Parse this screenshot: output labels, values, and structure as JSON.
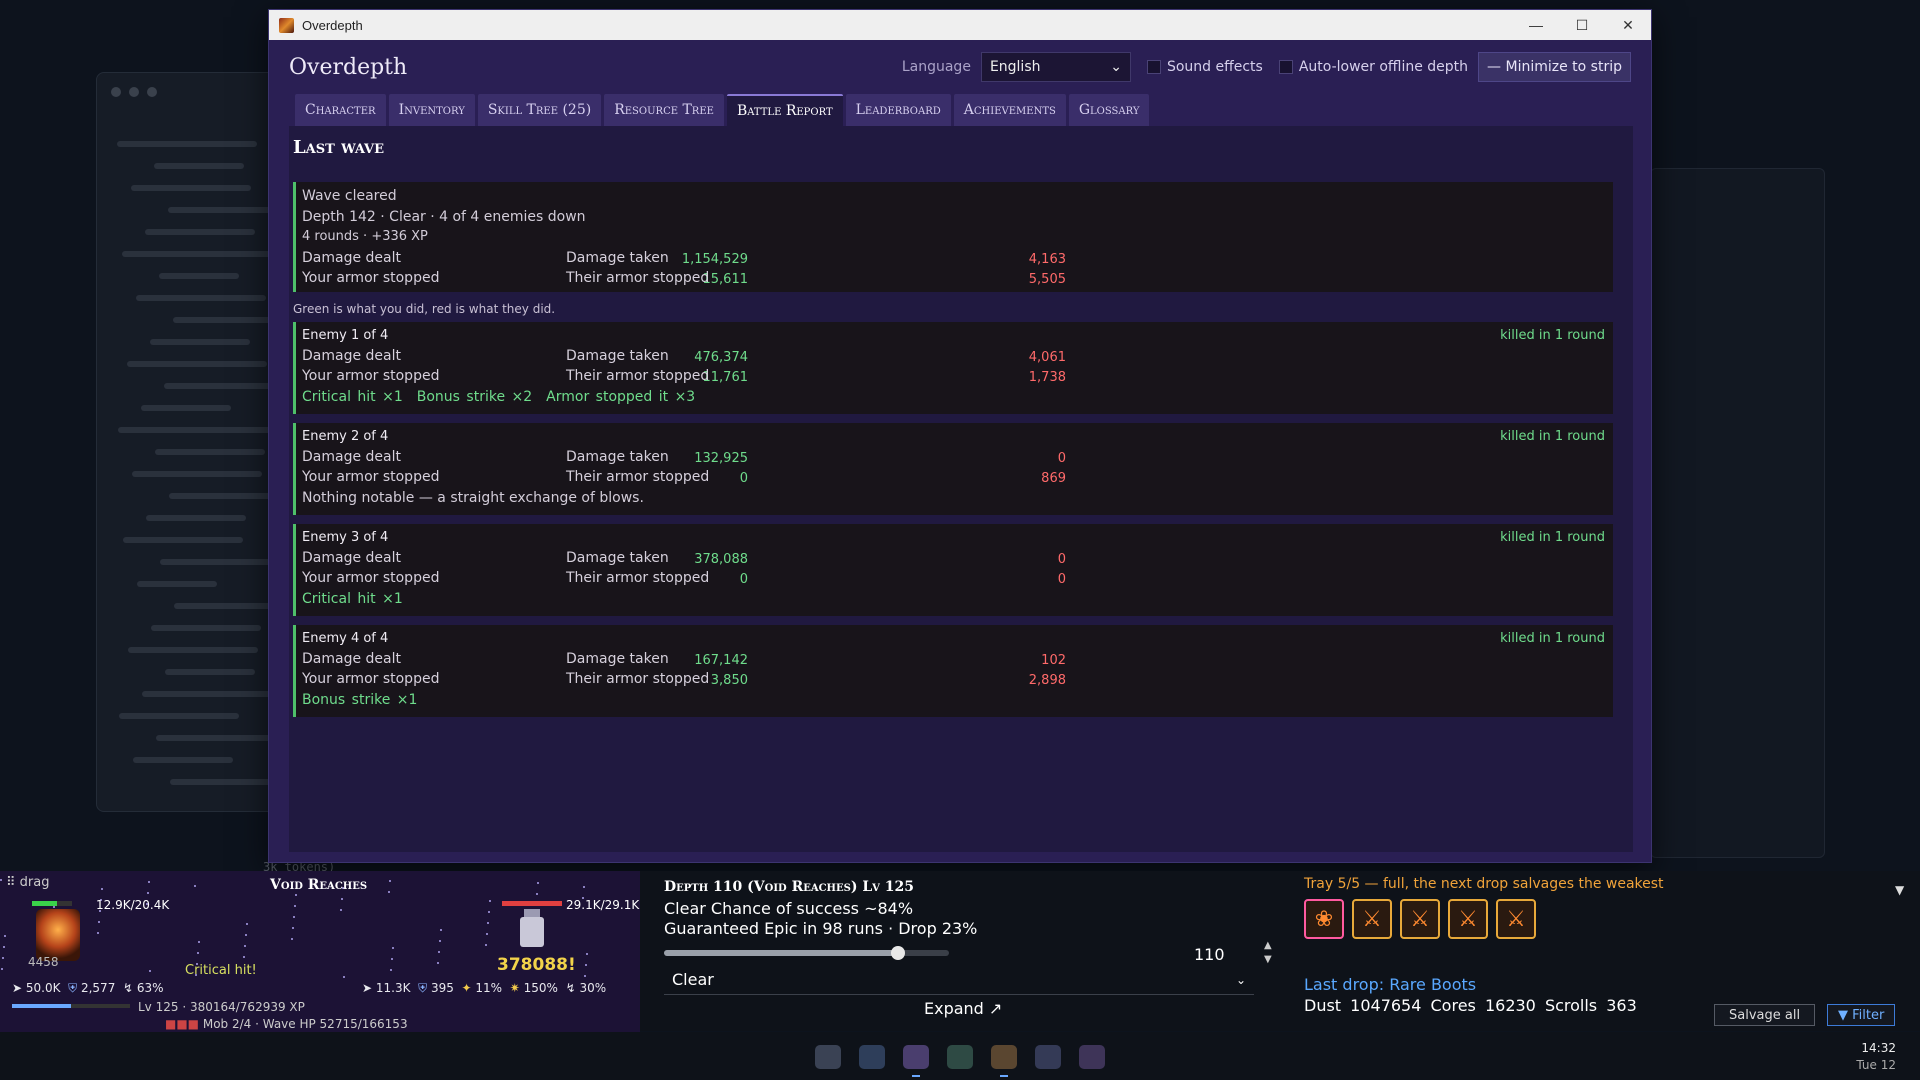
{
  "window": {
    "title": "Overdepth"
  },
  "header": {
    "app_name": "Overdepth",
    "language_label": "Language",
    "language_value": "English",
    "sound_effects": "Sound effects",
    "auto_lower": "Auto-lower offline depth",
    "minimize": "— Minimize to strip"
  },
  "tabs": [
    "Character",
    "Inventory",
    "Skill Tree (25)",
    "Resource Tree",
    "Battle Report",
    "Leaderboard",
    "Achievements",
    "Glossary"
  ],
  "active_tab": "Battle Report",
  "report": {
    "title": "Last wave",
    "summary": {
      "status": "Wave cleared",
      "depth_line": "Depth 142 · Clear · 4 of 4 enemies down",
      "rounds_line": "4 rounds · +336 XP",
      "damage_dealt_label": "Damage dealt",
      "damage_dealt": "1,154,529",
      "damage_taken_label": "Damage taken",
      "damage_taken": "4,163",
      "your_armor_label": "Your armor stopped",
      "your_armor": "15,611",
      "their_armor_label": "Their armor stopped",
      "their_armor": "5,505"
    },
    "legend_note": "Green is what you did, red is what they did.",
    "enemies": [
      {
        "title": "Enemy 1 of 4",
        "result": "killed in 1 round",
        "damage_dealt": "476,374",
        "damage_taken": "4,061",
        "your_armor": "11,761",
        "their_armor": "1,738",
        "tags": [
          "Critical hit ×1",
          "Bonus strike ×2",
          "Armor stopped it ×3"
        ],
        "note": ""
      },
      {
        "title": "Enemy 2 of 4",
        "result": "killed in 1 round",
        "damage_dealt": "132,925",
        "damage_taken": "0",
        "your_armor": "0",
        "their_armor": "869",
        "tags": [],
        "note": "Nothing notable — a straight exchange of blows."
      },
      {
        "title": "Enemy 3 of 4",
        "result": "killed in 1 round",
        "damage_dealt": "378,088",
        "damage_taken": "0",
        "your_armor": "0",
        "their_armor": "0",
        "tags": [
          "Critical hit ×1"
        ],
        "note": ""
      },
      {
        "title": "Enemy 4 of 4",
        "result": "killed in 1 round",
        "damage_dealt": "167,142",
        "damage_taken": "102",
        "your_armor": "3,850",
        "their_armor": "2,898",
        "tags": [
          "Bonus strike ×1"
        ],
        "note": ""
      }
    ],
    "labels": {
      "damage_dealt": "Damage dealt",
      "damage_taken": "Damage taken",
      "your_armor": "Your armor stopped",
      "their_armor": "Their armor stopped"
    }
  },
  "strip": {
    "drag": "⠿ drag",
    "zone": "Void Reaches",
    "player_hp": "12.9K/20.4K",
    "player_hp_fraction": 0.63,
    "enemy_hp": "29.1K/29.1K",
    "enemy_hp_fraction": 1.0,
    "crit_text": "Critical hit!",
    "damage_popup": "378088!",
    "player_power": "4458",
    "player_stats": {
      "attack": "50.0K",
      "armor": "2,577",
      "crit": "63%"
    },
    "enemy_stats": {
      "attack": "11.3K",
      "armor": "395",
      "evade": "11%",
      "crit_dmg": "150%",
      "crit": "30%"
    },
    "level_line": "Lv 125 · 380164/762939 XP",
    "xp_fraction": 0.5,
    "mob_line": "Mob 2/4 · Wave HP 52715/166153",
    "depth_title": "Depth 110 (Void Reaches) Lv 125",
    "chance_line": "Clear Chance of success ~84%",
    "guarantee_line": "Guaranteed Epic in 98 runs · Drop 23%",
    "depth_value": "110",
    "slider_fraction": 0.82,
    "mode_value": "Clear",
    "expand": "Expand ↗",
    "tray_title": "Tray 5/5 — full, the next drop salvages the weakest",
    "last_drop": "Last drop: Rare Boots",
    "resources": "Dust 1047654 Cores 16230 Scrolls 363",
    "salvage_all": "Salvage all",
    "filter": "▼ Filter"
  },
  "taskbar": {
    "time": "14:32",
    "date": "Tue 12"
  },
  "background": {
    "terminal_text": "3k tokens)"
  }
}
